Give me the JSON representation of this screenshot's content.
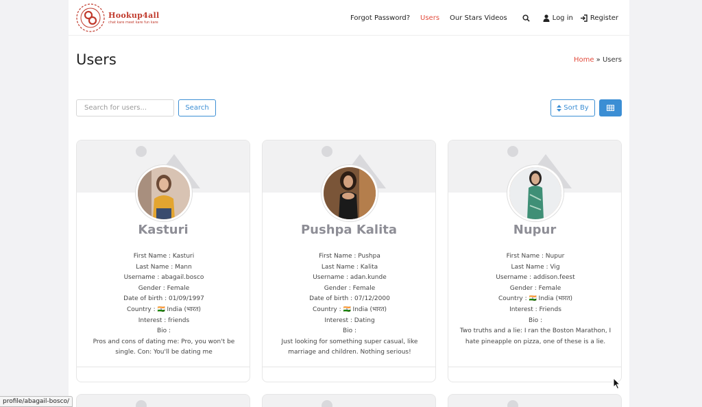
{
  "brand": {
    "name": "Hookup4all",
    "tagline": "chat kare meet kare fun kare"
  },
  "nav": {
    "forgot": "Forgot Password?",
    "users": "Users",
    "stars": "Our Stars Videos",
    "login": "Log in",
    "register": "Register"
  },
  "page": {
    "title": "Users",
    "breadcrumb": {
      "home": "Home",
      "sep": "»",
      "current": "Users"
    }
  },
  "search": {
    "placeholder": "Search for users...",
    "button": "Search"
  },
  "sort": {
    "label": "Sort By"
  },
  "colors": {
    "accent": "#e24a3b",
    "primary": "#3b8ed4",
    "name": "#8e8e96"
  },
  "users": [
    {
      "name": "Kasturi",
      "first": "First Name : Kasturi",
      "last": "Last Name : Mann",
      "username": "Username : abagail.bosco",
      "gender": "Gender : Female",
      "dob": "Date of birth : 01/09/1997",
      "country": "Country : 🇮🇳 India (भारत)",
      "interest": "Interest : friends",
      "bio_label": "Bio :",
      "bio": "Pros and cons of dating me: Pro, you won't be single. Con: You'll be dating me"
    },
    {
      "name": "Pushpa Kalita",
      "first": "First Name : Pushpa",
      "last": "Last Name : Kalita",
      "username": "Username : adan.kunde",
      "gender": "Gender : Female",
      "dob": "Date of birth : 07/12/2000",
      "country": "Country : 🇮🇳 India (भारत)",
      "interest": "Interest : Dating",
      "bio_label": "Bio :",
      "bio": "Just looking for something super casual, like marriage and children. Nothing serious!"
    },
    {
      "name": "Nupur",
      "first": "First Name : Nupur",
      "last": "Last Name : Vig",
      "username": "Username : addison.feest",
      "gender": "Gender : Female",
      "country": "Country : 🇮🇳 India (भारत)",
      "interest": "Interest : Friends",
      "bio_label": "Bio :",
      "bio": "Two truths and a lie: I ran the Boston Marathon, I hate pineapple on pizza, one of these is a lie."
    }
  ],
  "status_url": "profile/abagail-bosco/"
}
